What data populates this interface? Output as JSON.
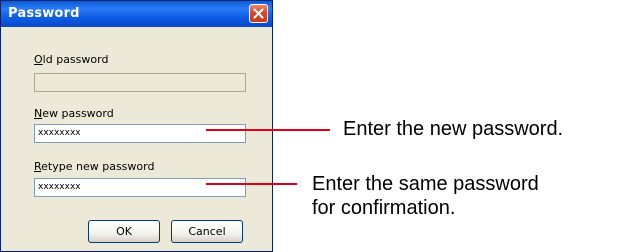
{
  "dialog": {
    "title": "Password",
    "old_password": {
      "label": "Old password",
      "mnemonic": "O",
      "label_rest": "ld password",
      "value": ""
    },
    "new_password": {
      "label": "New password",
      "mnemonic": "N",
      "label_rest": "ew password",
      "value": "xxxxxxxx"
    },
    "retype_password": {
      "label": "Retype new password",
      "mnemonic": "R",
      "label_rest": "etype new password",
      "value": "xxxxxxxx"
    },
    "ok_label": "OK",
    "cancel_label": "Cancel"
  },
  "annotations": {
    "new_password": "Enter the new password.",
    "retype_line1": "Enter the same password",
    "retype_line2": "for confirmation."
  },
  "colors": {
    "annotation_line": "#e0001b",
    "title_bar": "#0a5ad8",
    "dialog_bg": "#ece9d8"
  },
  "icons": {
    "close": "close-icon"
  }
}
